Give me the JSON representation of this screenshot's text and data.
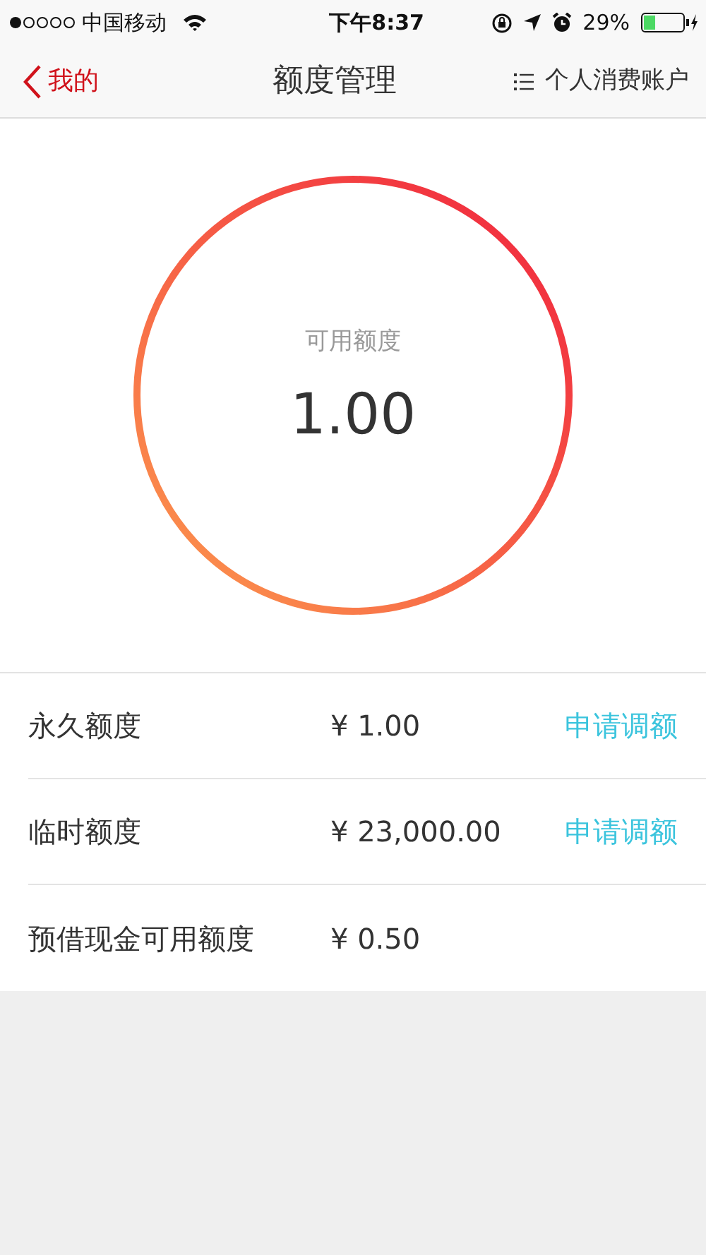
{
  "status_bar": {
    "carrier": "中国移动",
    "time": "下午8:37",
    "battery": "29%"
  },
  "nav": {
    "back": "我的",
    "title": "额度管理",
    "menu": "个人消费账户"
  },
  "gauge": {
    "label": "可用额度",
    "value": "1.00"
  },
  "rows": [
    {
      "label": "永久额度",
      "amount": "¥ 1.00",
      "action": "申请调额"
    },
    {
      "label": "临时额度",
      "amount": "¥ 23,000.00",
      "action": "申请调额"
    },
    {
      "label": "预借现金可用额度",
      "amount": "¥ 0.50"
    }
  ]
}
